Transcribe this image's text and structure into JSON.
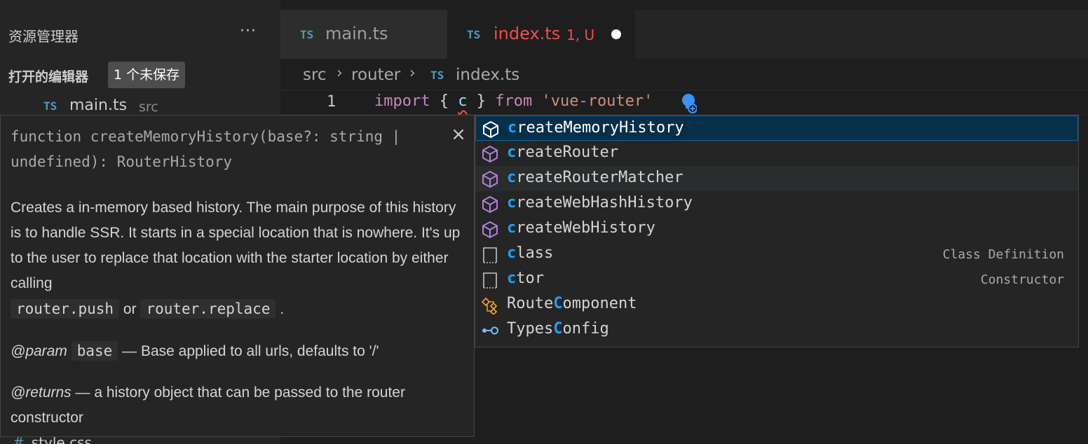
{
  "sidebar": {
    "title": "资源管理器",
    "more_glyph": "···",
    "open_editors_label": "打开的编辑器",
    "unsaved_badge": "1 个未保存",
    "open_file": {
      "type_glyph": "TS",
      "name": "main.ts",
      "dir": "src"
    },
    "bottom_item": {
      "glyph": "#",
      "name": "style.css"
    }
  },
  "tabs": [
    {
      "type_glyph": "TS",
      "label": "main.ts"
    },
    {
      "type_glyph": "TS",
      "label": "index.ts",
      "status": "1, U"
    }
  ],
  "breadcrumb": {
    "part1": "src",
    "part2": "router",
    "sep": "›",
    "type_glyph": "TS",
    "file": "index.ts"
  },
  "editor": {
    "line_number": "1",
    "code": {
      "keyword": "import",
      "open_brace": "{",
      "ident": "c",
      "close_brace": "}",
      "from": "from",
      "module": "'vue-router'"
    }
  },
  "suggestions": [
    {
      "icon": "cube-icon",
      "match": "c",
      "rest": "reateMemoryHistory",
      "detail": ""
    },
    {
      "icon": "cube-purple-icon",
      "match": "c",
      "rest": "reateRouter",
      "detail": ""
    },
    {
      "icon": "cube-purple-icon",
      "match": "c",
      "rest": "reateRouterMatcher",
      "detail": ""
    },
    {
      "icon": "cube-purple-icon",
      "match": "c",
      "rest": "reateWebHashHistory",
      "detail": ""
    },
    {
      "icon": "cube-purple-icon",
      "match": "c",
      "rest": "reateWebHistory",
      "detail": ""
    },
    {
      "icon": "snippet-icon",
      "match": "c",
      "rest": "lass",
      "detail": "Class Definition"
    },
    {
      "icon": "snippet-icon",
      "match": "c",
      "rest": "tor",
      "detail": "Constructor"
    },
    {
      "icon": "class-icon",
      "pre": "Route",
      "match": "C",
      "rest": "omponent",
      "detail": ""
    },
    {
      "icon": "interface-icon",
      "pre": "Types",
      "match": "C",
      "rest": "onfig",
      "detail": ""
    }
  ],
  "details": {
    "signature": "function createMemoryHistory(base?: string | undefined): RouterHistory",
    "close_glyph": "×",
    "doc_text": "Creates a in-memory based history. The main purpose of this history is to handle SSR. It starts in a special location that is nowhere. It's up to the user to replace that location with the starter location by either calling",
    "code1": "router.push",
    "or_text": "or",
    "code2": "router.replace",
    "period": ".",
    "param_tag": "@param",
    "param_name": "base",
    "param_desc": "— Base applied to all urls, defaults to '/'",
    "returns_tag": "@returns",
    "returns_desc": "— a history object that can be passed to the router constructor"
  },
  "colors": {
    "accent": "#18a3ff",
    "error": "#f14c4c",
    "ts_blue": "#519aba",
    "purple": "#b180d7",
    "orange": "#ee9d28"
  }
}
